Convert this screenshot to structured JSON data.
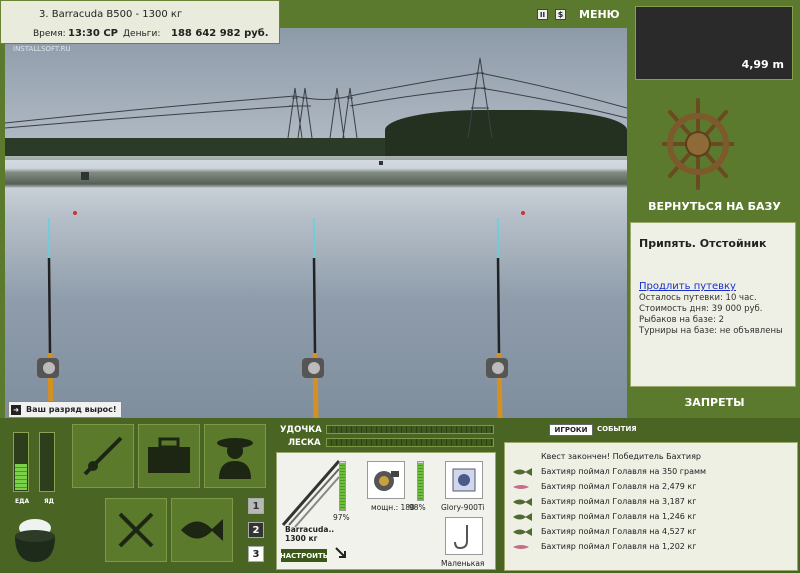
{
  "boat": {
    "name": "3. Barracuda B500 - 1300 кг"
  },
  "time": {
    "label": "Время:",
    "value": "13:30 СР"
  },
  "money": {
    "label": "Деньги:",
    "value": "188 642 982 руб."
  },
  "watermark": "INSTALLSOFT.RU",
  "top_buttons": {
    "pause": "II",
    "dollar": "$",
    "menu": "МЕНЮ"
  },
  "depth": "4,99 m",
  "return_label": "ВЕРНУТЬСЯ НА БАЗУ",
  "location": {
    "title": "Припять. Отстойник",
    "extend_link": "Продлить путевку",
    "lines": [
      "Осталось путевки: 10 час.",
      "Стоимость дня: 39 000 руб.",
      "Рыбаков на базе: 2",
      "Турниры на базе: не объявлены"
    ]
  },
  "bans_label": "ЗАПРЕТЫ",
  "notice": "Ваш разряд вырос!",
  "gauges": [
    {
      "label": "ЕДА",
      "level": 0.45
    },
    {
      "label": "ЯД",
      "level": 0
    }
  ],
  "numbers": [
    "1",
    "2",
    "3"
  ],
  "strip": {
    "rod_label": "УДОЧКА",
    "line_label": "ЛЕСКА"
  },
  "gear": {
    "rod_name": "Barracuda..",
    "rod_weight": "1300 кг",
    "rod_percent": "97%",
    "rod_level": 0.97,
    "reel_power": "мощн.: 180",
    "reel_percent": "98%",
    "reel_level": 0.98,
    "line_name": "Glory-900Ti",
    "hook_name": "Маленькая",
    "tune_button": "НАСТРОИТЬ"
  },
  "tabs": {
    "players": "ИГРОКИ",
    "events": "СОБЫТИЯ"
  },
  "events": [
    {
      "icon": "none",
      "text": "Квест закончен! Победитель Бахтияр"
    },
    {
      "icon": "fish-icon",
      "text": "Бахтияр поймал Голавля на 350 грамм"
    },
    {
      "icon": "lure-icon",
      "text": "Бахтияр поймал Голавля на 2,479 кг"
    },
    {
      "icon": "fish-icon",
      "text": "Бахтияр поймал Голавля на 3,187 кг"
    },
    {
      "icon": "fish-icon",
      "text": "Бахтияр поймал Голавля на 1,246 кг"
    },
    {
      "icon": "fish-icon",
      "text": "Бахтияр поймал Голавля на 4,527 кг"
    },
    {
      "icon": "lure-icon",
      "text": "Бахтияр поймал Голавля на 1,202 кг"
    }
  ],
  "colors": {
    "panel_green": "#5c7a2e",
    "accent_dark": "#3b5818",
    "gauge_fill": "#7bd24a"
  }
}
